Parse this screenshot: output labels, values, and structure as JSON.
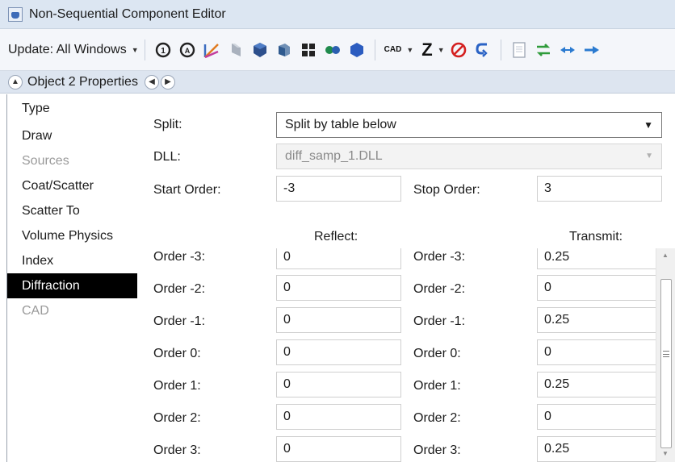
{
  "window": {
    "title": "Non-Sequential Component Editor"
  },
  "toolbar": {
    "update_label": "Update: All Windows",
    "cad_label": "CAD",
    "z_label": "Z",
    "icons": [
      "count-rays-icon",
      "count-all-rays-icon",
      "ray-trace-icon",
      "lens-icon",
      "cube-icon",
      "object-icon",
      "grid-icon",
      "two-dots-icon",
      "hexagon-icon",
      "cad-dropdown",
      "z-dropdown",
      "no-icon",
      "undo-icon",
      "document-icon",
      "swap-icon",
      "arrows-icon",
      "arrow-right-icon"
    ]
  },
  "properties": {
    "title": "Object 2 Properties"
  },
  "nav": {
    "items": [
      {
        "label": "Type",
        "state": "normal"
      },
      {
        "label": "Draw",
        "state": "normal"
      },
      {
        "label": "Sources",
        "state": "disabled"
      },
      {
        "label": "Coat/Scatter",
        "state": "normal"
      },
      {
        "label": "Scatter To",
        "state": "normal"
      },
      {
        "label": "Volume Physics",
        "state": "normal"
      },
      {
        "label": "Index",
        "state": "normal"
      },
      {
        "label": "Diffraction",
        "state": "active"
      },
      {
        "label": "CAD",
        "state": "disabled"
      }
    ]
  },
  "form": {
    "split_label": "Split:",
    "split_value": "Split by table below",
    "dll_label": "DLL:",
    "dll_value": "diff_samp_1.DLL",
    "start_order_label": "Start Order:",
    "start_order_value": "-3",
    "stop_order_label": "Stop Order:",
    "stop_order_value": "3",
    "reflect_header": "Reflect:",
    "transmit_header": "Transmit:",
    "reflect_rows": [
      {
        "label": "Order -3:",
        "value": "0"
      },
      {
        "label": "Order -2:",
        "value": "0"
      },
      {
        "label": "Order -1:",
        "value": "0"
      },
      {
        "label": "Order 0:",
        "value": "0"
      },
      {
        "label": "Order 1:",
        "value": "0"
      },
      {
        "label": "Order 2:",
        "value": "0"
      },
      {
        "label": "Order 3:",
        "value": "0"
      }
    ],
    "transmit_rows": [
      {
        "label": "Order -3:",
        "value": "0.25"
      },
      {
        "label": "Order -2:",
        "value": "0"
      },
      {
        "label": "Order -1:",
        "value": "0.25"
      },
      {
        "label": "Order 0:",
        "value": "0"
      },
      {
        "label": "Order 1:",
        "value": "0.25"
      },
      {
        "label": "Order 2:",
        "value": "0"
      },
      {
        "label": "Order 3:",
        "value": "0.25"
      }
    ]
  },
  "colors": {
    "active_nav_bg": "#000000",
    "active_nav_text": "#ffffff",
    "title_bar_bg": "#dce6f2"
  }
}
